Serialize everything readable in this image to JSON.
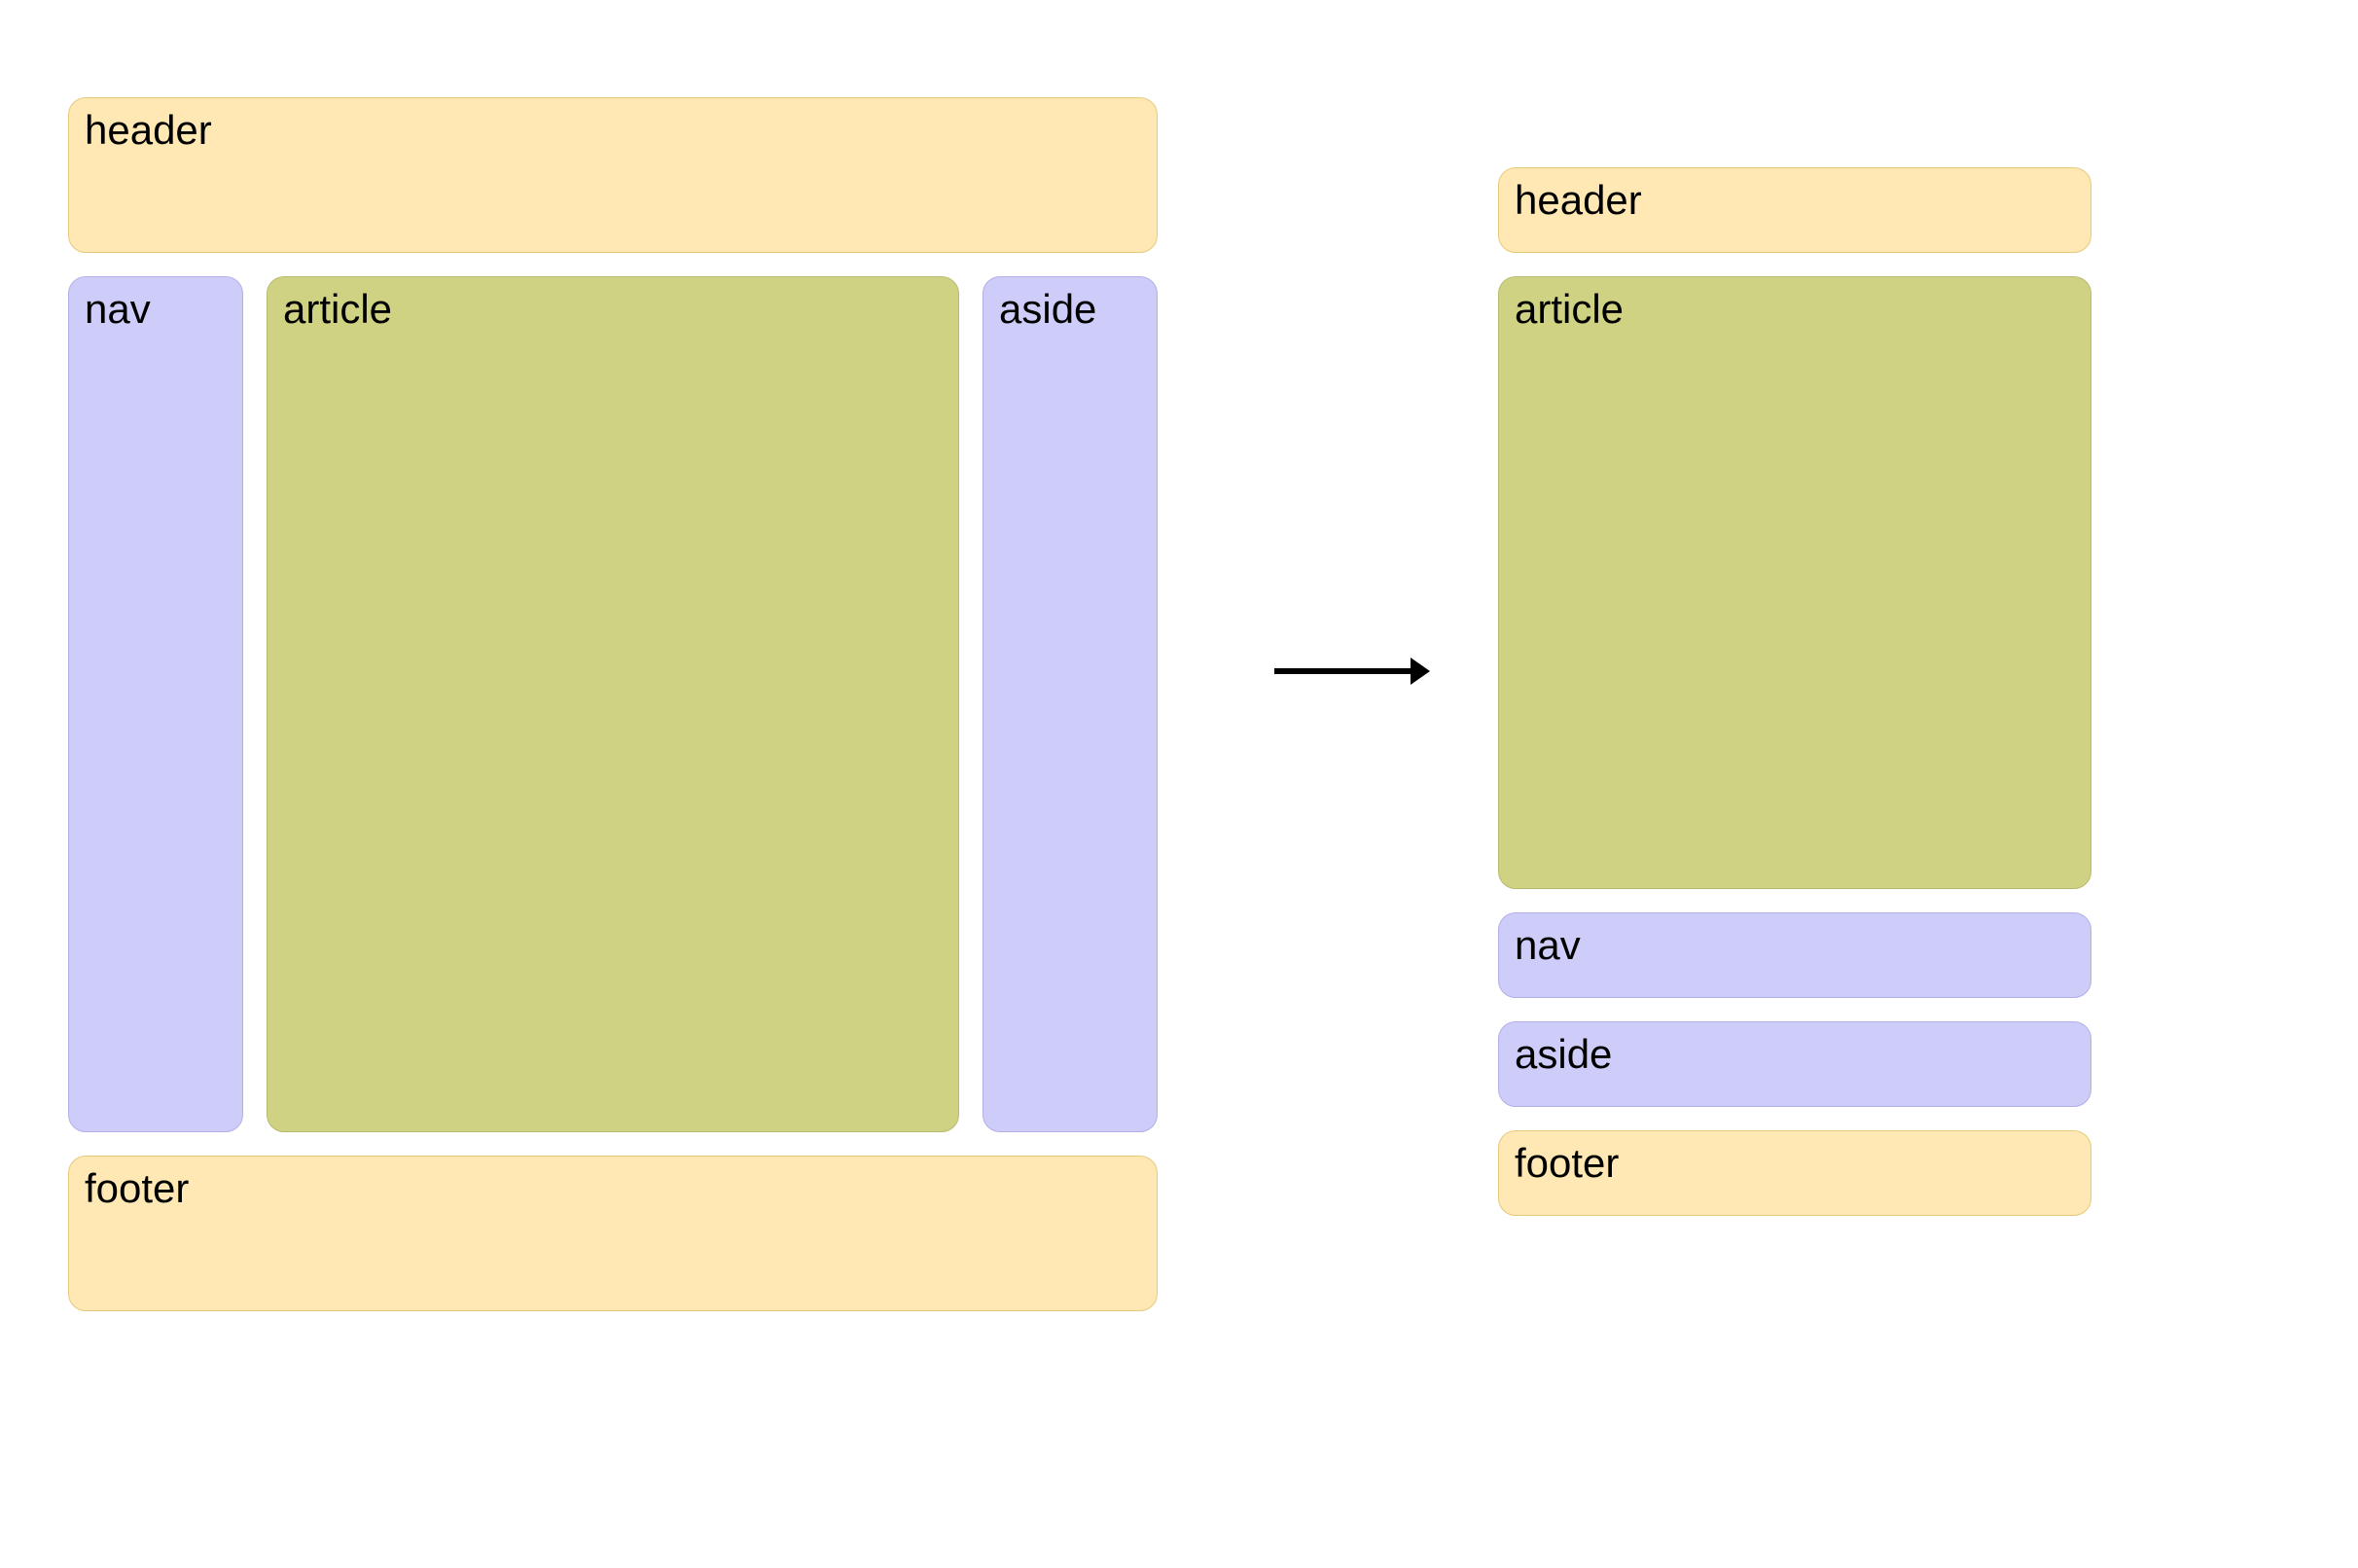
{
  "wide": {
    "header": "header",
    "nav": "nav",
    "article": "article",
    "aside": "aside",
    "footer": "footer"
  },
  "narrow": {
    "header": "header",
    "article": "article",
    "nav": "nav",
    "aside": "aside",
    "footer": "footer"
  },
  "colors": {
    "headerFooter": "#ffe8b3",
    "navAside": "#cecdf9",
    "article": "#cfd282"
  }
}
